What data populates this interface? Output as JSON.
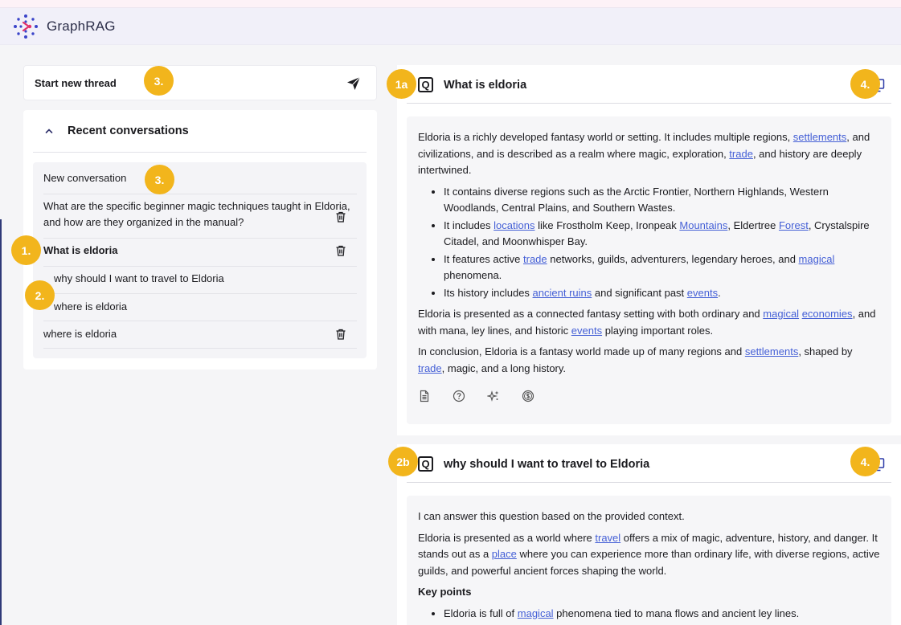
{
  "app": {
    "title": "GraphRAG"
  },
  "new_thread": {
    "label": "Start new thread",
    "badge": "3."
  },
  "recent": {
    "title": "Recent conversations",
    "items": [
      {
        "label": "New conversation",
        "badge": "3."
      },
      {
        "label": "What are the specific beginner magic techniques taught in Eldoria, and how are they organized in the manual?"
      },
      {
        "label": "What is eldoria",
        "badge": "1."
      },
      {
        "label": "why should I want to travel to Eldoria",
        "badge": "2."
      },
      {
        "label": "where is eldoria"
      },
      {
        "label": "where is eldoria"
      }
    ]
  },
  "thread": [
    {
      "badge": "1a",
      "q_label": "Q",
      "question": "What is eldoria",
      "copy_badge": "4.",
      "answer": {
        "p1": [
          "Eldoria is a richly developed fantasy world or setting. It includes multiple regions, ",
          "settlements",
          ", and civilizations, and is described as a realm where magic, exploration, ",
          "trade",
          ", and history are deeply intertwined."
        ],
        "bullets": [
          [
            "It contains diverse regions such as the Arctic Frontier, Northern Highlands, Western Woodlands, Central Plains, and Southern Wastes."
          ],
          [
            "It includes ",
            "locations",
            " like Frostholm Keep, Ironpeak ",
            "Mountains",
            ", Eldertree ",
            "Forest",
            ", Crystalspire Citadel, and Moonwhisper Bay."
          ],
          [
            "It features active ",
            "trade",
            " networks, guilds, adventurers, legendary heroes, and ",
            "magical",
            " phenomena."
          ],
          [
            "Its history includes ",
            "ancient ruins",
            " and significant past ",
            "events",
            "."
          ]
        ],
        "p2": [
          "Eldoria is presented as a connected fantasy setting with both ordinary and ",
          "magical",
          " ",
          "economies",
          ", and with mana, ley lines, and historic ",
          "events",
          " playing important roles."
        ],
        "p3": [
          "In conclusion, Eldoria is a fantasy world made up of many regions and ",
          "settlements",
          ", shaped by ",
          "trade",
          ", magic, and a long history."
        ]
      },
      "tools": [
        "document-icon",
        "help-circle-icon",
        "sparkles-icon",
        "coin-icon"
      ]
    },
    {
      "badge": "2b",
      "q_label": "Q",
      "question": "why should I want to travel to Eldoria",
      "copy_badge": "4.",
      "answer": {
        "p1": [
          "I can answer this question based on the provided context."
        ],
        "p2": [
          "Eldoria is presented as a world where ",
          "travel",
          " offers a mix of magic, adventure, history, and danger. It stands out as a ",
          "place",
          " where you can experience more than ordinary life, with diverse regions, active guilds, and powerful ancient forces shaping the world."
        ],
        "heading": "Key points",
        "bullets": [
          [
            "Eldoria is full of ",
            "magical",
            " phenomena tied to mana flows and ancient ley lines."
          ]
        ]
      }
    }
  ],
  "colors": {
    "badge": "#f2b51c",
    "link": "#4560d6",
    "header_bg": "#f1f0f9",
    "logo_blue": "#3a44c9",
    "logo_pink": "#e2336b"
  }
}
